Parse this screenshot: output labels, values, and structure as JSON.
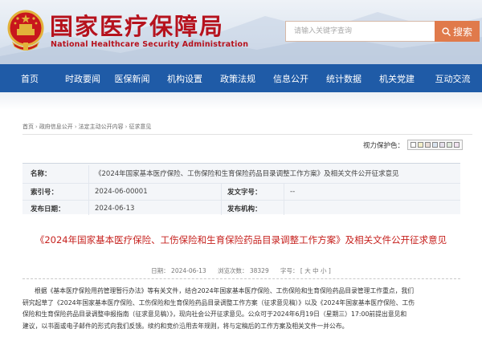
{
  "header": {
    "title_cn": "国家医疗保障局",
    "title_en": "National Healthcare Security Administration",
    "emblem_icon": "national-emblem-icon",
    "search_placeholder": "请输入关键字查询",
    "search_label": "搜索",
    "search_icon": "magnifier-icon",
    "brand_color": "#b6121d",
    "search_button_color": "#e07a4b"
  },
  "nav": {
    "color": "#1f5ba7",
    "items": [
      "首页",
      "时政要闻",
      "医保新闻",
      "机构设置",
      "政策法规",
      "信息公开",
      "统计数据",
      "机关党建",
      "互动交流"
    ]
  },
  "breadcrumb": [
    "首页",
    "政府信息公开",
    "法定主动公开内容",
    "征求意见"
  ],
  "vision": {
    "label": "视力保护色：",
    "swatches": [
      "#fefefe",
      "#f4efc9",
      "#e9dcd6",
      "#d9e4f0",
      "#e6e0ec",
      "#dfeadc",
      "#f1e2f0"
    ]
  },
  "meta": {
    "name_label": "名称：",
    "name_value": "《2024年国家基本医疗保险、工伤保险和生育保险药品目录调整工作方案》及相关文件公开征求意见",
    "index_label": "索引号：",
    "index_value": "2024-06-00001",
    "docno_label": "发文字号：",
    "docno_value": "--",
    "date_label": "发布日期：",
    "date_value": "2024-06-13",
    "org_label": "发布机构：",
    "org_value": ""
  },
  "article": {
    "title": "《2024年国家基本医疗保险、工伤保险和生育保险药品目录调整工作方案》及相关文件公开征求意见",
    "info_date": "日期： 2024-06-13",
    "info_views": "浏览次数： 38329",
    "info_font": "字号：",
    "font_sizes": "[ 大  中  小 ]",
    "paragraph_lines": [
      "根据《基本医疗保险用药管理暂行办法》等有关文件，结合2024年国家基本医疗保险、工伤保险和生育保险药品目录管理工作重点，我们",
      "研究起草了《2024年国家基本医疗保险、工伤保险和生育保险药品目录调整工作方案（征求意见稿）》以及《2024年国家基本医疗保险、工伤",
      "保险和生育保险药品目录调整申报指南（征求意见稿）》，现向社会公开征求意见。公众可于2024年6月19日（星期三）17:00前提出意见和",
      "建议，以书面或电子邮件的形式向我们反馈。续约和竞价沿用去年规则，将与定稿后的工作方案及相关文件一并公布。"
    ]
  }
}
